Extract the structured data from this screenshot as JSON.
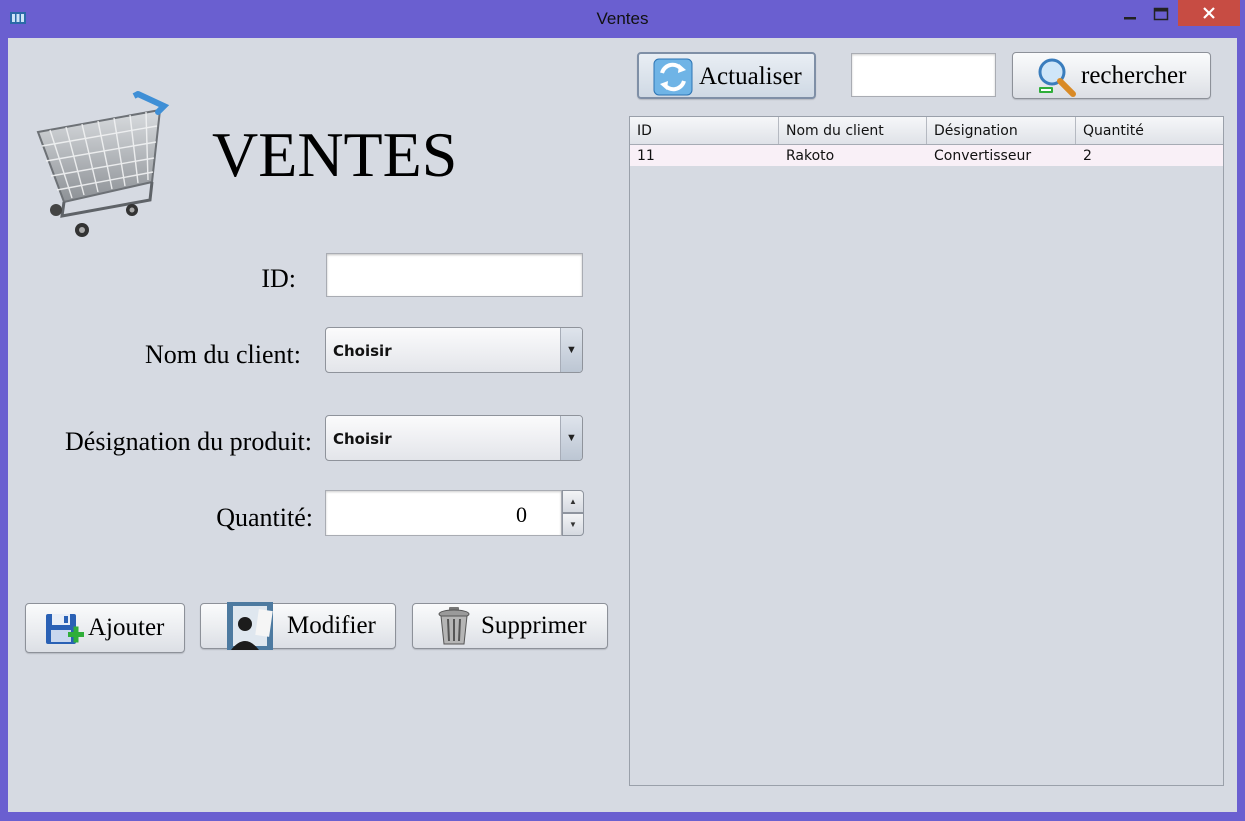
{
  "window": {
    "title": "Ventes",
    "controls": {
      "minimize": "—",
      "maximize": "☐",
      "close": "✕"
    }
  },
  "header": {
    "title": "VENTES"
  },
  "form": {
    "id_label": "ID:",
    "id_value": "",
    "client_label": "Nom du client:",
    "client_value": "Choisir",
    "product_label": "Désignation du produit:",
    "product_value": "Choisir",
    "quantity_label": "Quantité:",
    "quantity_value": "0"
  },
  "actions": {
    "add_label": "Ajouter",
    "edit_label": "Modifier",
    "delete_label": "Supprimer"
  },
  "toolbar": {
    "refresh_label": "Actualiser",
    "search_value": "",
    "search_label": "rechercher"
  },
  "table": {
    "columns": [
      "ID",
      "Nom du client",
      "Désignation",
      "Quantité"
    ],
    "rows": [
      [
        "11",
        "Rakoto",
        "Convertisseur",
        "2"
      ]
    ]
  },
  "colors": {
    "window_frame": "#6a5fd0",
    "client_bg": "#d6dae2",
    "close_button": "#c74c43",
    "selected_row": "#f9f0f7"
  },
  "icons": [
    "app-icon",
    "shopping-cart-icon",
    "refresh-icon",
    "search-icon",
    "save-add-icon",
    "edit-person-icon",
    "trash-icon",
    "dropdown-arrow-icon"
  ]
}
